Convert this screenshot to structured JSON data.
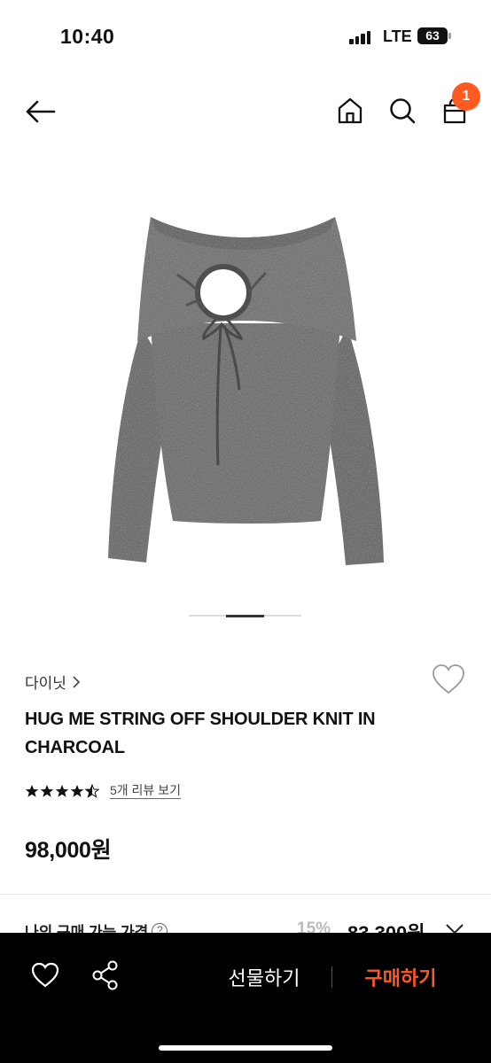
{
  "status_bar": {
    "time": "10:40",
    "network": "LTE",
    "battery": "63"
  },
  "nav": {
    "back_icon": "arrow-left-icon",
    "home_icon": "home-icon",
    "search_icon": "search-icon",
    "cart_icon": "shopping-bag-icon",
    "cart_badge": "1",
    "badge_color": "#ff5a1f"
  },
  "product": {
    "image_description_icon": "sweater-image",
    "carousel": {
      "total": 3,
      "active_index": 1
    },
    "brand": "다이닛",
    "title": "HUG ME STRING OFF SHOULDER KNIT IN CHARCOAL",
    "rating": {
      "value": 4.5,
      "max": 5
    },
    "review_link": "5개 리뷰 보기",
    "price": "98,000원"
  },
  "my_price": {
    "label": "나의 구매 가능 가격",
    "help_icon": "?",
    "discount": "15%",
    "price": "83,300원"
  },
  "bottom_bar": {
    "wishlist_icon": "heart-icon",
    "share_icon": "share-icon",
    "gift_label": "선물하기",
    "buy_label": "구매하기",
    "buy_color": "#ff5a1f"
  }
}
